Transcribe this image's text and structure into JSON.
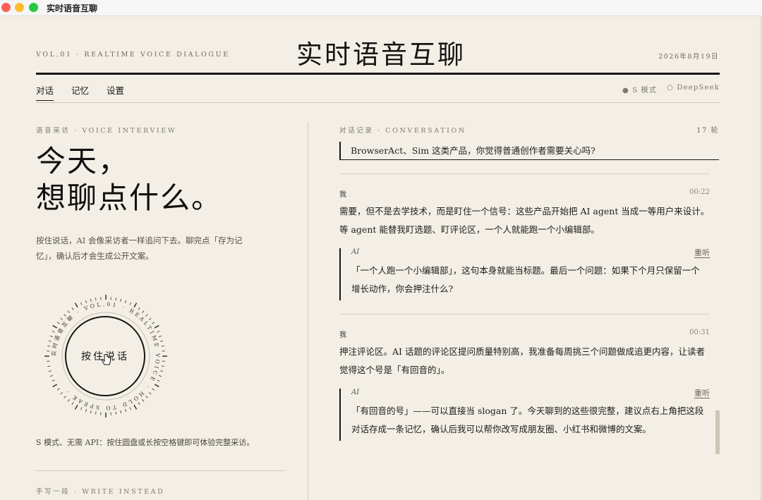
{
  "window": {
    "title": "实时语音互聊"
  },
  "masthead": {
    "vol": "VOL.01 · REALTIME VOICE DIALOGUE",
    "title": "实时语音互聊",
    "date": "2026年8月19日"
  },
  "nav": {
    "tabs": [
      {
        "label": "对话",
        "active": true
      },
      {
        "label": "记忆",
        "active": false
      },
      {
        "label": "设置",
        "active": false
      }
    ],
    "modes": [
      "● S 模式",
      "○ DeepSeek"
    ]
  },
  "left": {
    "eyebrow": "语音采访 · VOICE INTERVIEW",
    "headline_line1": "今天，",
    "headline_line2": "想聊点什么。",
    "intro": "按住说话，AI 会像采访者一样追问下去。聊完点「存为记忆」，确认后才会生成公开文案。",
    "dial_ring_text": "实时语音互聊 · VOL.01 · REALTIME VOICE · HOLD TO SPEAK · ",
    "talk_button": "按住说话",
    "hint": "S 模式、无需 API：按住圆盘或长按空格键即可体验完整采访。",
    "write_eyebrow": "手写一段 · WRITE INSTEAD"
  },
  "conversation": {
    "eyebrow": "对话记录 · CONVERSATION",
    "count": "17 轮",
    "top_quote": "BrowserAct、Sim 这类产品，你觉得普通创作者需要关心吗?",
    "turns": [
      {
        "who": "我",
        "time": "00:22",
        "text": "需要，但不是去学技术，而是盯住一个信号：这些产品开始把 AI agent 当成一等用户来设计。等 agent 能替我盯选题、盯评论区，一个人就能跑一个小编辑部。",
        "ai_label": "AI",
        "replay": "重听",
        "ai_text": "「一个人跑一个小编辑部」，这句本身就能当标题。最后一个问题：如果下个月只保留一个增长动作，你会押注什么?"
      },
      {
        "who": "我",
        "time": "00:31",
        "text": "押注评论区。AI 话题的评论区提问质量特别高，我准备每周挑三个问题做成追更内容，让读者觉得这个号是「有回音的」。",
        "ai_label": "AI",
        "replay": "重听",
        "ai_text": "「有回音的号」——可以直接当 slogan 了。今天聊到的这些很完整，建议点右上角把这段对话存成一条记忆，确认后我可以帮你改写成朋友圈、小红书和微博的文案。"
      }
    ]
  },
  "colors": {
    "ink": "#161616",
    "paper": "#f3efe6",
    "muted": "#7e7b72"
  },
  "icons": [
    "close-icon",
    "minimize-icon",
    "zoom-icon",
    "hand-cursor-icon"
  ]
}
